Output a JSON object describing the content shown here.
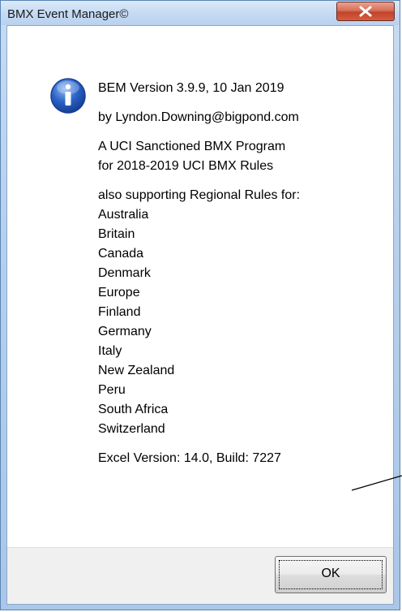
{
  "window": {
    "title": "BMX Event Manager©"
  },
  "message": {
    "version_line": "BEM Version 3.9.9, 10 Jan 2019",
    "author_line": "by Lyndon.Downing@bigpond.com",
    "program_line_1": "A UCI Sanctioned BMX Program",
    "program_line_2": "for 2018-2019 UCI BMX Rules",
    "regional_intro": "also supporting Regional Rules for:",
    "regions": [
      "Australia",
      "Britain",
      "Canada",
      "Denmark",
      "Europe",
      "Finland",
      "Germany",
      "Italy",
      "New Zealand",
      "Peru",
      "South Africa",
      "Switzerland"
    ],
    "excel_line": "Excel Version: 14.0, Build: 7227"
  },
  "buttons": {
    "ok_label": "OK"
  },
  "icons": {
    "info": "info-icon",
    "close": "close-icon"
  },
  "colors": {
    "title_bar": "#c6dbf3",
    "close_button": "#c2442a",
    "info_icon": "#2a63c7",
    "button_bar": "#f0f0f0"
  }
}
